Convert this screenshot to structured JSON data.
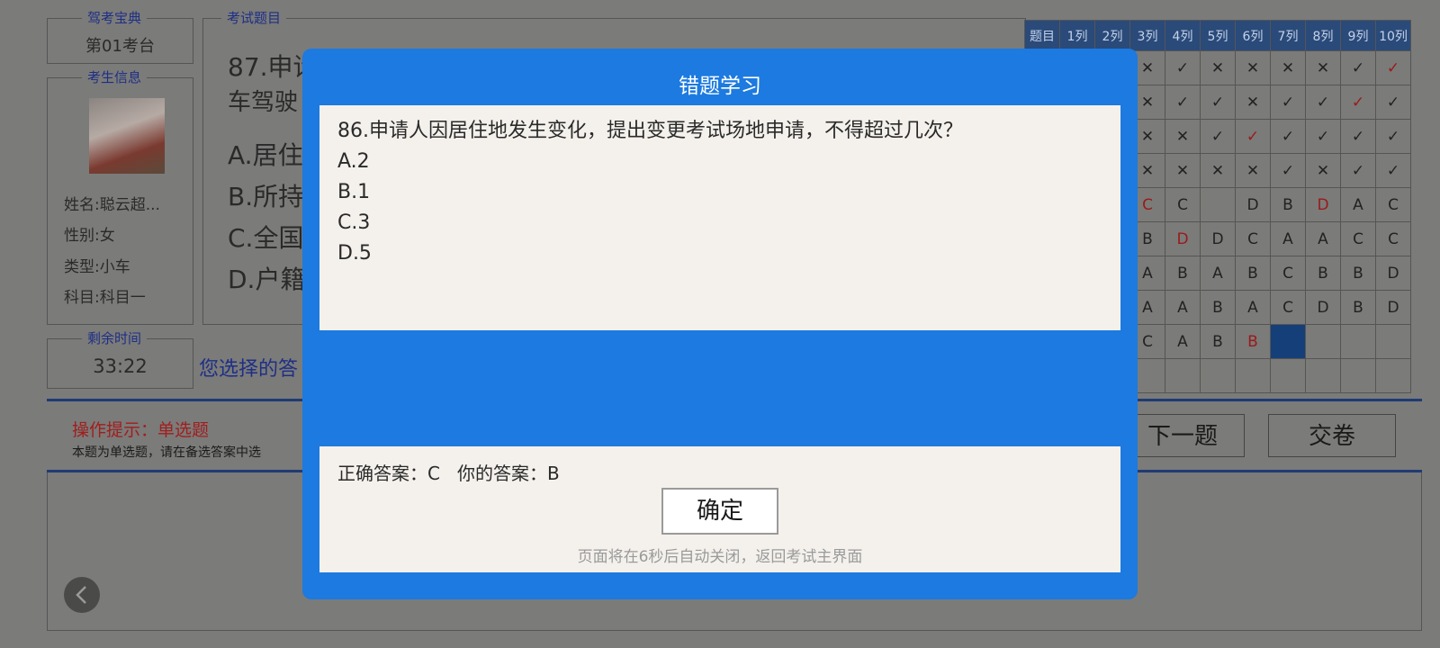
{
  "exam_room": {
    "legend": "驾考宝典",
    "value": "第01考台"
  },
  "student": {
    "legend": "考生信息",
    "name": "姓名:聪云超...",
    "gender": "性别:女",
    "type": "类型:小车",
    "subject": "科目:科目一"
  },
  "timer": {
    "legend": "剩余时间",
    "value": "33:22"
  },
  "question_panel": {
    "legend": "考试题目",
    "line1": "87.申请",
    "line2": "车驾驶",
    "options": [
      "A.居住",
      "B.所持",
      "C.全国",
      "D.户籍"
    ]
  },
  "selected_answer_label": "您选择的答",
  "hint": {
    "title": "操作提示：单选题",
    "text": "本题为单选题，请在备选答案中选"
  },
  "buttons": {
    "next": "下一题",
    "submit": "交卷"
  },
  "grid": {
    "headers": [
      "题目",
      "1列",
      "2列",
      "3列",
      "4列",
      "5列",
      "6列",
      "7列",
      "8列",
      "9列",
      "10列"
    ],
    "rows": [
      [
        "",
        "",
        "",
        "✕",
        "✓",
        "✕",
        "✕",
        "✕",
        "✕",
        "✓",
        "✓"
      ],
      [
        "",
        "",
        "",
        "✕",
        "✓",
        "✓",
        "✕",
        "✓",
        "✓",
        "✓",
        "✓"
      ],
      [
        "",
        "",
        "",
        "✕",
        "✕",
        "✓",
        "✓",
        "✓",
        "✓",
        "✓",
        "✓"
      ],
      [
        "",
        "",
        "",
        "✕",
        "✕",
        "✕",
        "✕",
        "✓",
        "✕",
        "✓",
        "✓"
      ],
      [
        "",
        "",
        "",
        "C",
        "C",
        "",
        "D",
        "B",
        "D",
        "A",
        "C"
      ],
      [
        "",
        "",
        "",
        "B",
        "D",
        "D",
        "C",
        "A",
        "A",
        "C",
        "C"
      ],
      [
        "",
        "",
        "",
        "A",
        "B",
        "A",
        "B",
        "C",
        "B",
        "B",
        "D"
      ],
      [
        "",
        "",
        "",
        "A",
        "A",
        "B",
        "A",
        "C",
        "D",
        "B",
        "D"
      ],
      [
        "",
        "",
        "",
        "C",
        "A",
        "B",
        "B",
        "",
        "",
        "",
        ""
      ],
      [
        "",
        "",
        "",
        "",
        "",
        "",
        "",
        "",
        "",
        "",
        ""
      ]
    ],
    "red_cells": [
      "0-10",
      "1-9",
      "2-6",
      "4-3",
      "4-8",
      "5-4",
      "8-6"
    ],
    "current_cell": "8-7"
  },
  "modal": {
    "title": "错题学习",
    "question": "86.申请人因居住地发生变化，提出变更考试场地申请，不得超过几次？",
    "options": [
      "A.2",
      "B.1",
      "C.3",
      "D.5"
    ],
    "answer_line": "正确答案：C   你的答案：B",
    "ok_label": "确定",
    "auto_close": "页面将在6秒后自动关闭，返回考试主界面"
  },
  "colors": {
    "modal_bg": "#1c7ae0",
    "panel_bg": "#f4f1ec",
    "legend_blue": "#1e2f86",
    "hint_red": "#a01e1e"
  },
  "icons": {
    "back": "chevron-left-icon"
  }
}
